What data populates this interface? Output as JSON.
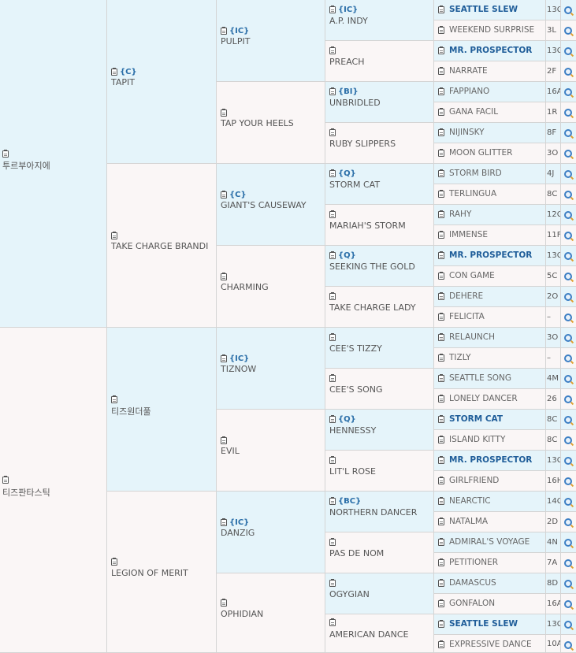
{
  "pedigree": {
    "gen1": [
      {
        "name": "투르부아지에",
        "grade": ""
      },
      {
        "name": "티즈판타스틱",
        "grade": ""
      }
    ],
    "gen2": [
      {
        "name": "TAPIT",
        "grade": "{C}"
      },
      {
        "name": "TAKE CHARGE BRANDI",
        "grade": ""
      },
      {
        "name": "티즈원더풀",
        "grade": ""
      },
      {
        "name": "LEGION OF MERIT",
        "grade": ""
      }
    ],
    "gen3": [
      {
        "name": "PULPIT",
        "grade": "{IC}"
      },
      {
        "name": "TAP YOUR HEELS",
        "grade": ""
      },
      {
        "name": "GIANT'S CAUSEWAY",
        "grade": "{C}"
      },
      {
        "name": "CHARMING",
        "grade": ""
      },
      {
        "name": "TIZNOW",
        "grade": "{IC}"
      },
      {
        "name": "EVIL",
        "grade": ""
      },
      {
        "name": "DANZIG",
        "grade": "{IC}"
      },
      {
        "name": "OPHIDIAN",
        "grade": ""
      }
    ],
    "gen4": [
      {
        "name": "A.P. INDY",
        "grade": "{IC}"
      },
      {
        "name": "PREACH",
        "grade": ""
      },
      {
        "name": "UNBRIDLED",
        "grade": "{BI}"
      },
      {
        "name": "RUBY SLIPPERS",
        "grade": ""
      },
      {
        "name": "STORM CAT",
        "grade": "{Q}"
      },
      {
        "name": "MARIAH'S STORM",
        "grade": ""
      },
      {
        "name": "SEEKING THE GOLD",
        "grade": "{Q}"
      },
      {
        "name": "TAKE CHARGE LADY",
        "grade": ""
      },
      {
        "name": "CEE'S TIZZY",
        "grade": ""
      },
      {
        "name": "CEE'S SONG",
        "grade": ""
      },
      {
        "name": "HENNESSY",
        "grade": "{Q}"
      },
      {
        "name": "LIT'L ROSE",
        "grade": ""
      },
      {
        "name": "NORTHERN DANCER",
        "grade": "{BC}"
      },
      {
        "name": "PAS DE NOM",
        "grade": ""
      },
      {
        "name": "OGYGIAN",
        "grade": ""
      },
      {
        "name": "AMERICAN DANCE",
        "grade": ""
      }
    ],
    "gen5": [
      {
        "name": "SEATTLE SLEW",
        "stallion": true,
        "info": "13C"
      },
      {
        "name": "WEEKEND SURPRISE",
        "stallion": false,
        "info": "3L"
      },
      {
        "name": "MR. PROSPECTOR",
        "stallion": true,
        "info": "13C"
      },
      {
        "name": "NARRATE",
        "stallion": false,
        "info": "2F"
      },
      {
        "name": "FAPPIANO",
        "stallion": false,
        "info": "16A"
      },
      {
        "name": "GANA FACIL",
        "stallion": false,
        "info": "1R"
      },
      {
        "name": "NIJINSKY",
        "stallion": false,
        "info": "8F"
      },
      {
        "name": "MOON GLITTER",
        "stallion": false,
        "info": "3O"
      },
      {
        "name": "STORM BIRD",
        "stallion": false,
        "info": "4J"
      },
      {
        "name": "TERLINGUA",
        "stallion": false,
        "info": "8C"
      },
      {
        "name": "RAHY",
        "stallion": false,
        "info": "12C"
      },
      {
        "name": "IMMENSE",
        "stallion": false,
        "info": "11F"
      },
      {
        "name": "MR. PROSPECTOR",
        "stallion": true,
        "info": "13C"
      },
      {
        "name": "CON GAME",
        "stallion": false,
        "info": "5C"
      },
      {
        "name": "DEHERE",
        "stallion": false,
        "info": "2O"
      },
      {
        "name": "FELICITA",
        "stallion": false,
        "info": "–"
      },
      {
        "name": "RELAUNCH",
        "stallion": false,
        "info": "3O"
      },
      {
        "name": "TIZLY",
        "stallion": false,
        "info": "–"
      },
      {
        "name": "SEATTLE SONG",
        "stallion": false,
        "info": "4M"
      },
      {
        "name": "LONELY DANCER",
        "stallion": false,
        "info": "26"
      },
      {
        "name": "STORM CAT",
        "stallion": true,
        "info": "8C"
      },
      {
        "name": "ISLAND KITTY",
        "stallion": false,
        "info": "8C"
      },
      {
        "name": "MR. PROSPECTOR",
        "stallion": true,
        "info": "13C"
      },
      {
        "name": "GIRLFRIEND",
        "stallion": false,
        "info": "16H"
      },
      {
        "name": "NEARCTIC",
        "stallion": false,
        "info": "14C"
      },
      {
        "name": "NATALMA",
        "stallion": false,
        "info": "2D"
      },
      {
        "name": "ADMIRAL'S VOYAGE",
        "stallion": false,
        "info": "4N"
      },
      {
        "name": "PETITIONER",
        "stallion": false,
        "info": "7A"
      },
      {
        "name": "DAMASCUS",
        "stallion": false,
        "info": "8D"
      },
      {
        "name": "GONFALON",
        "stallion": false,
        "info": "16A"
      },
      {
        "name": "SEATTLE SLEW",
        "stallion": true,
        "info": "13C"
      },
      {
        "name": "EXPRESSIVE DANCE",
        "stallion": false,
        "info": "10A"
      }
    ]
  },
  "colors": {
    "sire_bg": "#e5f4fa",
    "dam_bg": "#faf6f6",
    "grade": "#2a6ea8",
    "stallion_link": "#1f5d99"
  }
}
